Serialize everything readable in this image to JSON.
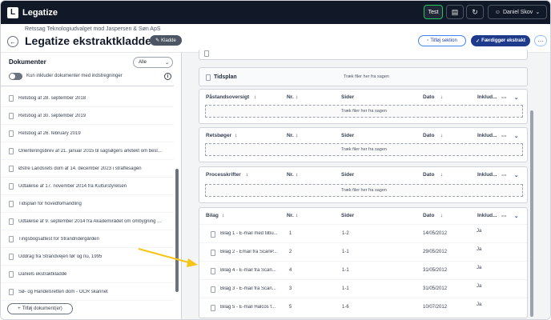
{
  "app": {
    "name": "Legatize"
  },
  "topbar": {
    "test_label": "Test",
    "user_name": "Daniel Skov"
  },
  "header": {
    "subtitle": "Retssag Teknologiudvalget mod Jaspersen & Søn ApS",
    "title": "Legatize ekstraktkladde",
    "draft_badge": "Kladde",
    "add_section_label": "Tilføj sektion",
    "finish_label": "Færdiggør ekstrakt",
    "more_label": "···"
  },
  "sidebar": {
    "title": "Dokumenter",
    "filter_value": "Alle",
    "toggle_label": "Kun inkluder dokumenter med indstregninger",
    "documents": [
      "Retsbog af 28. september 2018",
      "Retsbog af 30. september 2019",
      "Retsbog af 26. february 2019",
      "Orienteringsbrev af 21. januar 2015 til sagsøgers arkitekt om besl...",
      "Østre Landsrets dom af 14. december 2023 i straffesagen",
      "Udtalelse af 17. november 2014 fra Kulturstyrelsen",
      "Tidsplan for hovedforhandling",
      "Udtalelse af 9. september 2014 fra Akademirådet om ombygning ...",
      "Tingsbogsattest for Strandridergården",
      "Uddrag fra Strandvejen før og nu, 1995",
      "Daniels ekstraktkladde",
      "Sø- og Handelsretten dom - OCR skannet"
    ],
    "add_doc_label": "Tilføj dokument(er)"
  },
  "main": {
    "top_partial_label": "",
    "tidsplan": {
      "name": "Tidsplan",
      "drop_text": "Træk filer her fra sagen"
    },
    "columns": {
      "nr": "Nr.",
      "sider": "Sider",
      "dato": "Dato",
      "inkluder": "Inklud..."
    },
    "sections": [
      {
        "name": "Påstandsoversigt",
        "drop_text": "Træk filer her fra sagen"
      },
      {
        "name": "Retsbøger",
        "drop_text": "Træk filer her fra sagen"
      },
      {
        "name": "Processkrifter",
        "drop_text": "Træk filer her fra sagen"
      }
    ],
    "bilag": {
      "name": "Bilag",
      "rows": [
        {
          "name": "Bilag 1 - E-mail med tilbu...",
          "nr": "1",
          "sider": "1-2",
          "dato": "14/05/2012",
          "inkluder": "Ja"
        },
        {
          "name": "Bilag 2 - Email fra ScanP...",
          "nr": "2",
          "sider": "1-1",
          "dato": "29/05/2012",
          "inkluder": "Ja"
        },
        {
          "name": "Bilag 4 - E-mail fra Scan...",
          "nr": "4",
          "sider": "1-1",
          "dato": "31/05/2012",
          "inkluder": "Ja"
        },
        {
          "name": "Bilag 3 - E-mail fra Scan...",
          "nr": "3",
          "sider": "1-1",
          "dato": "31/05/2012",
          "inkluder": "Ja"
        },
        {
          "name": "Bilag 5 - E-mail Halcos f...",
          "nr": "5",
          "sider": "1-6",
          "dato": "10/07/2012",
          "inkluder": "Ja"
        }
      ]
    }
  },
  "colors": {
    "topbar": "#111827",
    "accent": "#1e3a8a",
    "arrow": "#f5c518",
    "test_border": "#22c55e"
  },
  "icons": [
    "logo-icon",
    "bell-icon",
    "refresh-icon",
    "user-icon",
    "back-arrow-icon",
    "pencil-icon",
    "document-icon",
    "check-icon",
    "info-icon",
    "plus-icon",
    "sort-icon",
    "more-icon",
    "chevron-down-icon"
  ]
}
